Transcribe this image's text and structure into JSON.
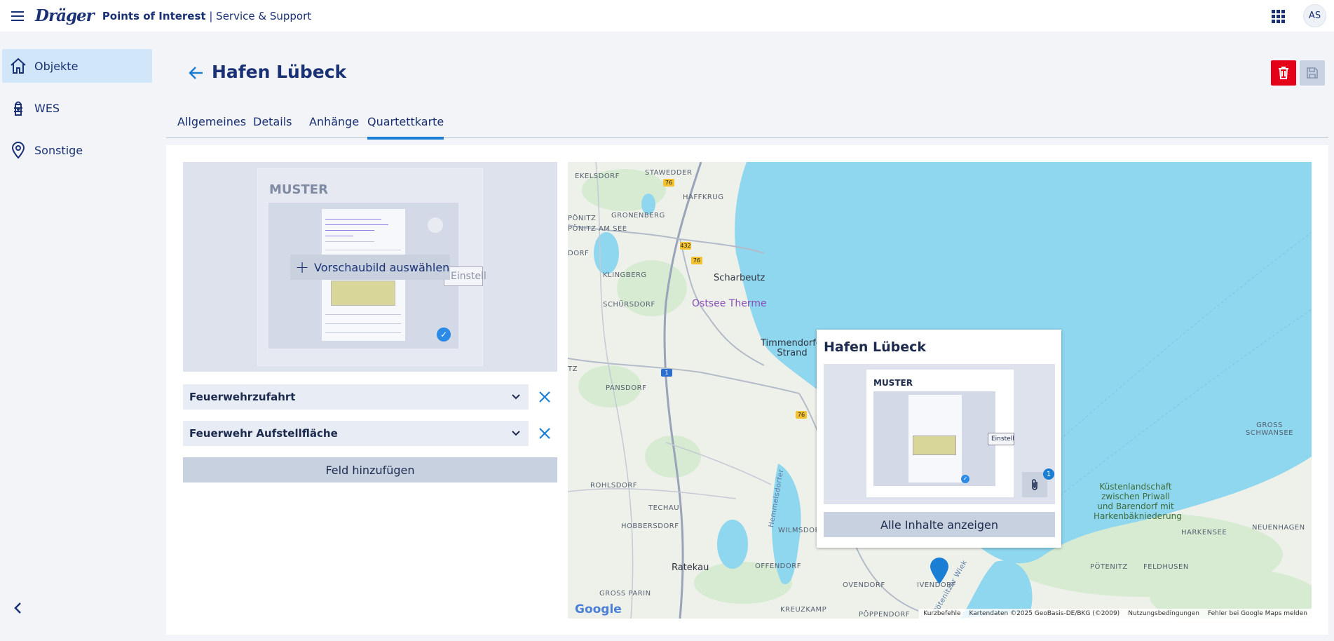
{
  "header": {
    "logo": "Dräger",
    "title_bold": "Points of Interest",
    "title_rest": " | Service & Support",
    "avatar": "AS"
  },
  "sidebar": {
    "items": [
      {
        "label": "Objekte",
        "icon": "home-icon",
        "active": true
      },
      {
        "label": "WES",
        "icon": "hydrant-icon",
        "active": false
      },
      {
        "label": "Sonstige",
        "icon": "location-pin-icon",
        "active": false
      }
    ]
  },
  "page": {
    "title": "Hafen Lübeck",
    "tabs": [
      {
        "label": "Allgemeines",
        "active": false
      },
      {
        "label": "Details",
        "active": false
      },
      {
        "label": "Anhänge",
        "active": false
      },
      {
        "label": "Quartettkarte",
        "active": true
      }
    ]
  },
  "preview": {
    "watermark": "MUSTER",
    "select_button": "Vorschaubild auswählen",
    "einstell_fragment": "Einstell"
  },
  "fields": [
    {
      "value": "Feuerwehrzufahrt"
    },
    {
      "value": "Feuerwehr Aufstellfläche"
    }
  ],
  "add_field_button": "Feld hinzufügen",
  "map": {
    "places": [
      "STAWEDDER",
      "EKELSDORF",
      "HAFFKRUG",
      "GRONENBERG",
      "PÖNITZ",
      "PÖNITZ AM SEE",
      "DORF",
      "KLINGBERG",
      "Scharbeutz",
      "Ostsee Therme",
      "SCHÜRSDORF",
      "Timmendorfer Strand",
      "TZ",
      "PANSDORF",
      "ROHLSDORF",
      "TECHAU",
      "HOBBERSDORF",
      "WILMSDORF",
      "Ratekau",
      "OFFENDORF",
      "OVENDORF",
      "GROSS PARIN",
      "KREUZKAMP",
      "PÖPPENDORF",
      "IVENDORF",
      "PÖTENITZ",
      "FELDHUSEN",
      "HARKENSEE",
      "NEUENHAGEN",
      "GROSS SCHWANSEE",
      "Küstenlandschaft zwischen Priwall und Barendorf mit Harkenbäkniederung",
      "Hemmelsdorfer",
      "Pötenitzer Wiek"
    ],
    "road_numbers": [
      "76",
      "432",
      "76",
      "1",
      "76"
    ],
    "attribution": [
      "Kurzbefehle",
      "Kartendaten ©2025 GeoBasis-DE/BKG (©2009)",
      "Nutzungsbedingungen",
      "Fehler bei Google Maps melden"
    ],
    "google": "Google",
    "popup": {
      "title": "Hafen Lübeck",
      "watermark": "MUSTER",
      "einstell_fragment": "Einstell",
      "attachment_count": "1",
      "button": "Alle Inhalte anzeigen"
    }
  },
  "colors": {
    "brand": "#1a3275",
    "accent": "#1a7fd4",
    "delete": "#e50019",
    "water": "#8fd6ef"
  }
}
